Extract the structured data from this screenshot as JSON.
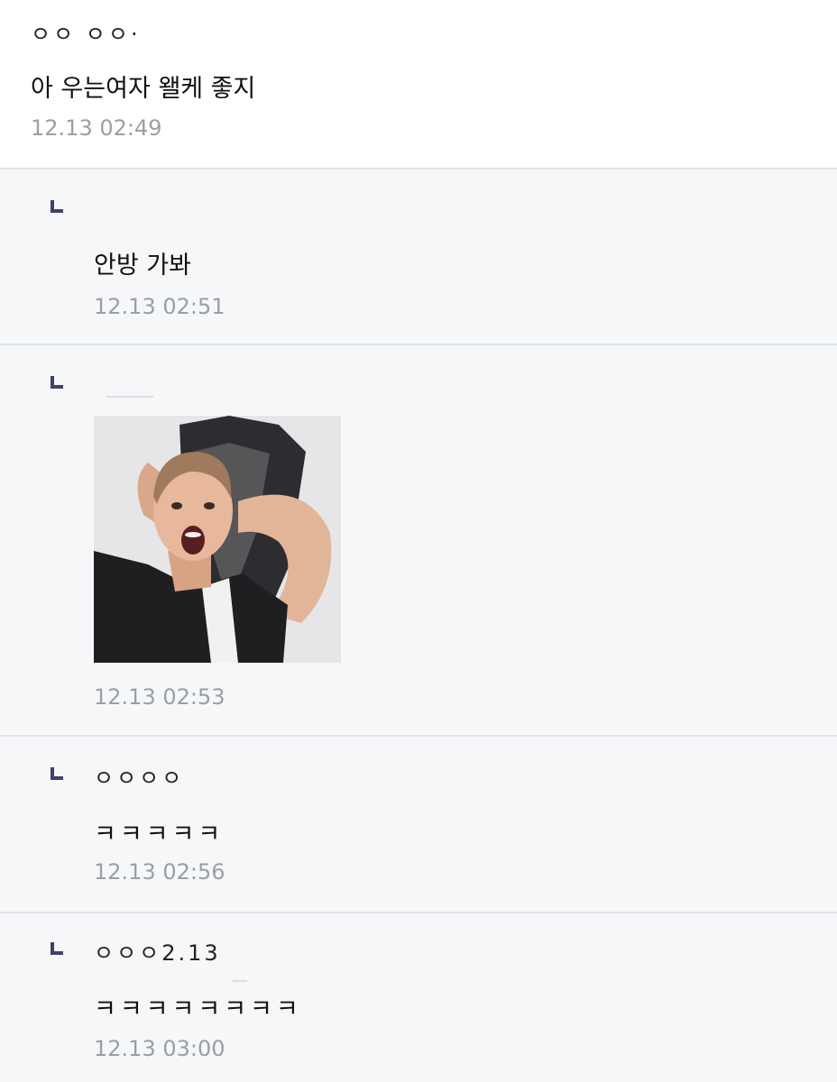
{
  "comments": [
    {
      "author": "ㅇㅇ ㅇㅇ·",
      "text": "아 우는여자 왤케 좋지",
      "time": "12.13 02:49"
    },
    {
      "author": "",
      "text": "안방 가봐",
      "time": "12.13 02:51"
    },
    {
      "author": "",
      "text": "",
      "time": "12.13 02:53",
      "image": "shocked-man-sticker"
    },
    {
      "author": "ㅇㅇㅇㅇ",
      "text": "ㅋㅋㅋㅋㅋ",
      "time": "12.13 02:56"
    },
    {
      "author": "ㅇㅇㅇ2.13",
      "text": "ㅋㅋㅋㅋㅋㅋㅋㅋ",
      "time": "12.13 03:00"
    }
  ],
  "colors": {
    "reply_background": "#f6f7f9",
    "divider": "#e2e4e8",
    "reply_mark": "#3c4170",
    "timestamp": "#9a9ea6"
  },
  "icons": {
    "reply": "reply-arrow-icon"
  }
}
